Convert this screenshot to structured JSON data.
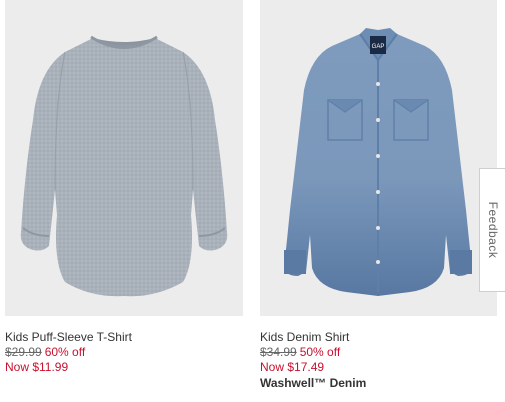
{
  "products": [
    {
      "name": "Kids Puff-Sleeve T-Shirt",
      "was_price": "$29.99",
      "discount": "60% off",
      "now_price": "Now $11.99",
      "subtitle": ""
    },
    {
      "name": "Kids Denim Shirt",
      "was_price": "$34.99",
      "discount": "50% off",
      "now_price": "Now $17.49",
      "subtitle": "Washwell™ Denim",
      "logo_text": "GAP"
    }
  ],
  "feedback": {
    "label": "Feedback"
  }
}
